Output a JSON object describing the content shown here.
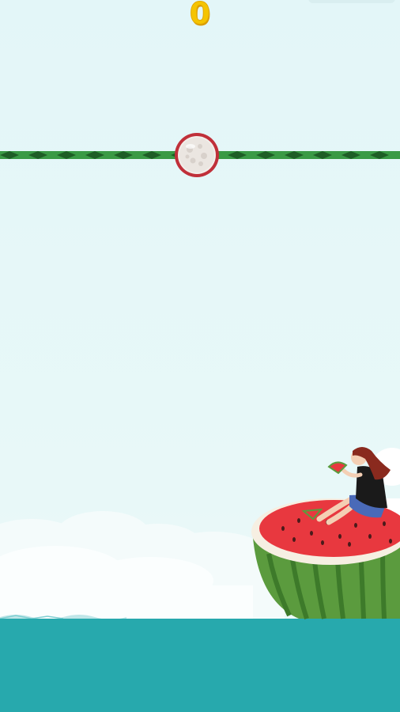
{
  "hud": {
    "score": "0"
  },
  "colors": {
    "sky": "#e3f6f8",
    "sea": "#27a9ad",
    "rope_green": "#2f8f3a",
    "rope_dark": "#1e5e26",
    "ball_rim": "#c0303a",
    "score_yellow": "#f5c400",
    "melon_red": "#e8383f",
    "melon_rind": "#5b9b3e"
  },
  "icons": {
    "ball": "lychee-ball-icon",
    "player": "girl-on-watermelon-icon"
  }
}
